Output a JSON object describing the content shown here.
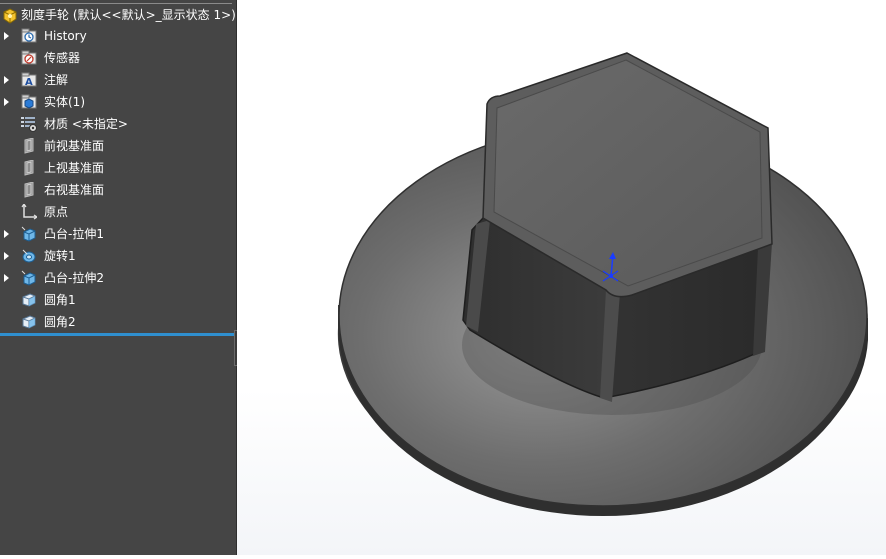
{
  "feature_tree": {
    "root_label": "刻度手轮 (默认<<默认>_显示状态 1>)",
    "items": [
      {
        "label": "History",
        "icon": "history-icon",
        "expandable": true
      },
      {
        "label": "传感器",
        "icon": "sensor-icon",
        "expandable": false
      },
      {
        "label": "注解",
        "icon": "annotation-icon",
        "expandable": true
      },
      {
        "label": "实体(1)",
        "icon": "solid-bodies-icon",
        "expandable": true
      },
      {
        "label": "材质 <未指定>",
        "icon": "material-icon",
        "expandable": false
      },
      {
        "label": "前视基准面",
        "icon": "plane-icon",
        "expandable": false
      },
      {
        "label": "上视基准面",
        "icon": "plane-icon",
        "expandable": false
      },
      {
        "label": "右视基准面",
        "icon": "plane-icon",
        "expandable": false
      },
      {
        "label": "原点",
        "icon": "origin-icon",
        "expandable": false
      },
      {
        "label": "凸台-拉伸1",
        "icon": "boss-extrude-icon",
        "expandable": true
      },
      {
        "label": "旋转1",
        "icon": "revolve-icon",
        "expandable": true
      },
      {
        "label": "凸台-拉伸2",
        "icon": "boss-extrude-icon",
        "expandable": true
      },
      {
        "label": "圆角1",
        "icon": "fillet-icon",
        "expandable": false
      },
      {
        "label": "圆角2",
        "icon": "fillet-icon",
        "expandable": false
      }
    ]
  },
  "colors": {
    "panel_bg": "#454545",
    "rollback_bar": "#2f8fcf",
    "model_body": "#555555",
    "triad_blue": "#1a3cff"
  }
}
